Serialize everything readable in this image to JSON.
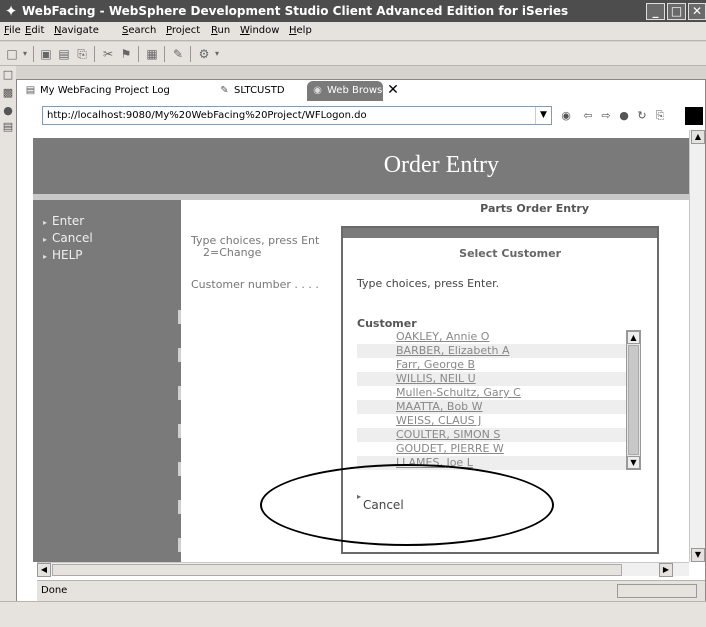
{
  "window": {
    "title": "WebFacing - WebSphere Development Studio Client Advanced Edition for iSeries"
  },
  "menu": [
    {
      "label": "File",
      "accel": "F",
      "rest": "ile"
    },
    {
      "label": "Edit",
      "accel": "E",
      "rest": "dit"
    },
    {
      "label": "Navigate",
      "accel": "N",
      "rest": "avigate"
    },
    {
      "label": "Search",
      "accel": "S",
      "rest": "earch"
    },
    {
      "label": "Project",
      "accel": "P",
      "rest": "roject"
    },
    {
      "label": "Run",
      "accel": "R",
      "rest": "un"
    },
    {
      "label": "Window",
      "accel": "W",
      "rest": "indow"
    },
    {
      "label": "Help",
      "accel": "H",
      "rest": "elp"
    }
  ],
  "tabs": {
    "log": "My WebFacing Project Log",
    "sltcustd": "SLTCUSTD",
    "browser": "Web Browser"
  },
  "browser": {
    "url": "http://localhost:9080/My%20WebFacing%20Project/WFLogon.do",
    "status": "Done"
  },
  "page": {
    "app_title": "Order Entry",
    "nav": [
      "Enter",
      "Cancel",
      "HELP"
    ],
    "content_title": "Parts Order Entry",
    "instruction": "Type choices, press Ent",
    "option": "2=Change",
    "customer_prompt": "Customer number . . . ."
  },
  "dialog": {
    "title": "Select Customer",
    "instruction": "Type choices, press Enter.",
    "list_label": "Customer",
    "customers": [
      "OAKLEY, Annie O",
      "BARBER, Elizabeth A",
      "Farr, George B",
      "WILLIS, NEIL U",
      "Mullen-Schultz, Gary C",
      "MAATTA, Bob W",
      "WEISS, CLAUS J",
      "COULTER, SIMON S",
      "GOUDET, PIERRE W",
      "LLAMES, Joe L"
    ],
    "cancel": "Cancel"
  },
  "colors": {
    "header_gray": "#7a7a7a",
    "title_bar": "#4d4d4d"
  }
}
